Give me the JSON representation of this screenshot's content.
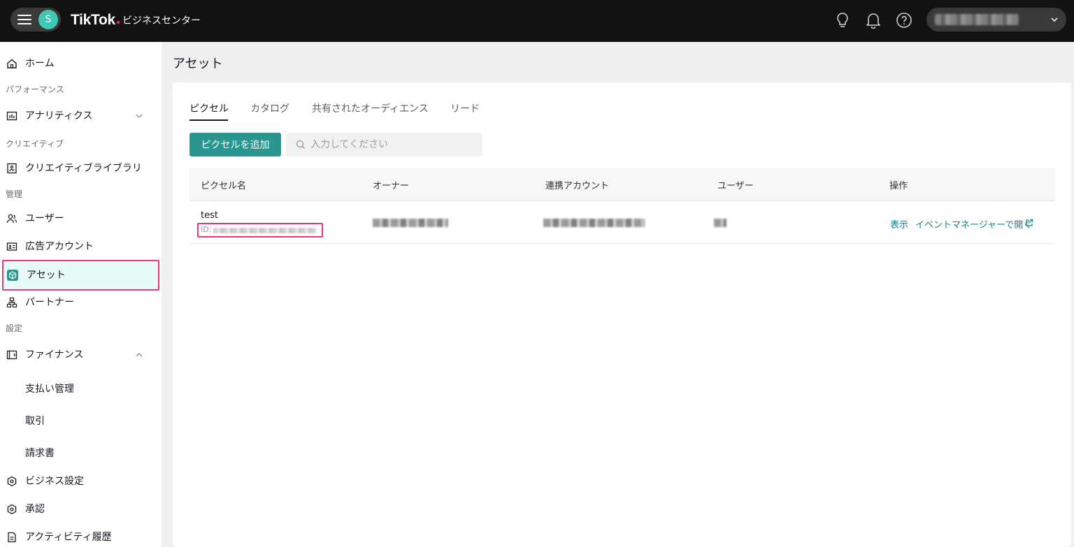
{
  "header": {
    "avatar_letter": "S",
    "brand": "TikTok",
    "brand_sub": "ビジネスセンター",
    "accent": "#fe2c55"
  },
  "sidebar": {
    "home": "ホーム",
    "section_performance": "パフォーマンス",
    "analytics": "アナリティクス",
    "section_creative": "クリエイティブ",
    "creative_library": "クリエイティブライブラリ",
    "section_manage": "管理",
    "users": "ユーザー",
    "ad_accounts": "広告アカウント",
    "assets": "アセット",
    "partners": "パートナー",
    "section_settings": "設定",
    "finance": "ファイナンス",
    "payments": "支払い管理",
    "transactions": "取引",
    "invoices": "請求書",
    "business_settings": "ビジネス設定",
    "approvals": "承認",
    "activity_log": "アクティビティ履歴"
  },
  "main": {
    "title": "アセット",
    "tabs": [
      "ピクセル",
      "カタログ",
      "共有されたオーディエンス",
      "リード"
    ],
    "active_tab": "ピクセル",
    "add_button": "ピクセルを追加",
    "search_placeholder": "入力してください",
    "table": {
      "columns": [
        "ピクセル名",
        "オーナー",
        "連携アカウント",
        "ユーザー",
        "操作"
      ],
      "rows": [
        {
          "name": "test",
          "id_label": "ID:",
          "actions": {
            "view": "表示",
            "open": "イベントマネージャーで開く"
          }
        }
      ]
    }
  },
  "colors": {
    "primary": "#2a9690",
    "link": "#1b7f86",
    "highlight": "#e5387a"
  }
}
